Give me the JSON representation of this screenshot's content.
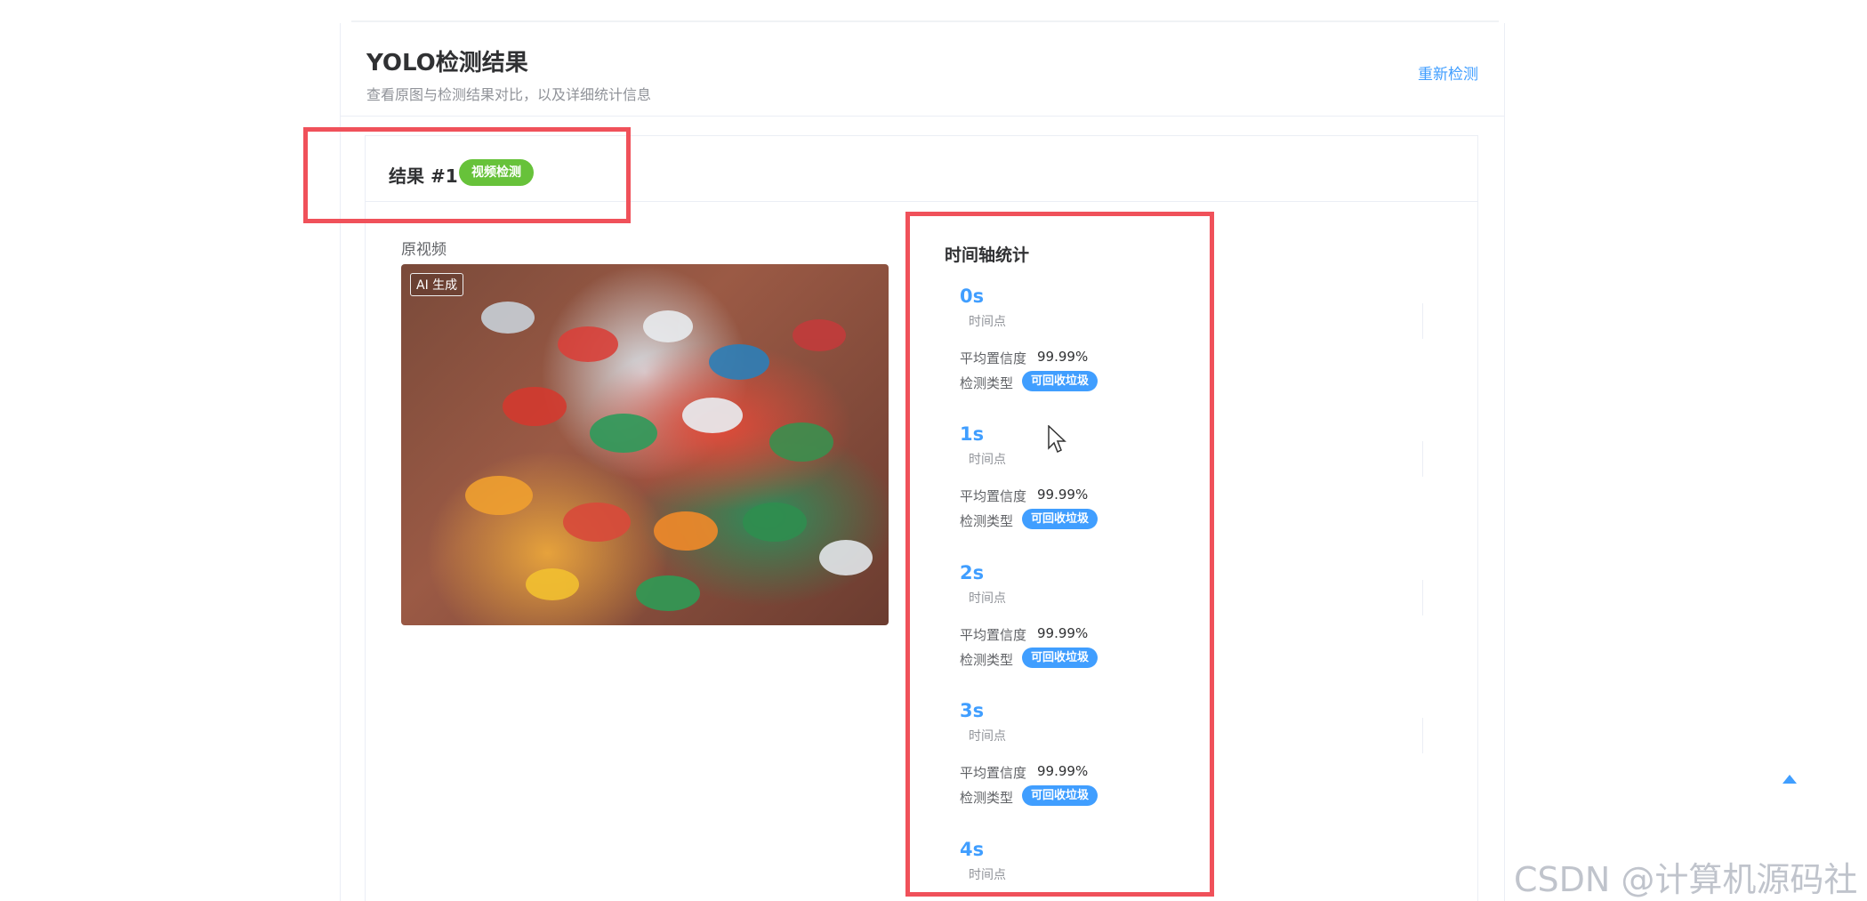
{
  "header": {
    "title": "YOLO检测结果",
    "subtitle": "查看原图与检测结果对比，以及详细统计信息",
    "redetect_label": "重新检测"
  },
  "result": {
    "title": "结果 #1",
    "tag": "视频检测",
    "original_label": "原视频",
    "ai_badge": "AI 生成"
  },
  "timeline": {
    "title": "时间轴统计",
    "items": [
      {
        "time": "0s",
        "sub": "时间点",
        "conf_label": "平均置信度",
        "conf_value": "99.99%",
        "type_label": "检测类型",
        "type_tag": "可回收垃圾"
      },
      {
        "time": "1s",
        "sub": "时间点",
        "conf_label": "平均置信度",
        "conf_value": "99.99%",
        "type_label": "检测类型",
        "type_tag": "可回收垃圾"
      },
      {
        "time": "2s",
        "sub": "时间点",
        "conf_label": "平均置信度",
        "conf_value": "99.99%",
        "type_label": "检测类型",
        "type_tag": "可回收垃圾"
      },
      {
        "time": "3s",
        "sub": "时间点",
        "conf_label": "平均置信度",
        "conf_value": "99.99%",
        "type_label": "检测类型",
        "type_tag": "可回收垃圾"
      },
      {
        "time": "4s",
        "sub": "时间点"
      }
    ]
  },
  "watermark": "CSDN @计算机源码社",
  "colors": {
    "accent": "#409eff",
    "video_tag": "#67c23a",
    "highlight": "#f0515a"
  }
}
